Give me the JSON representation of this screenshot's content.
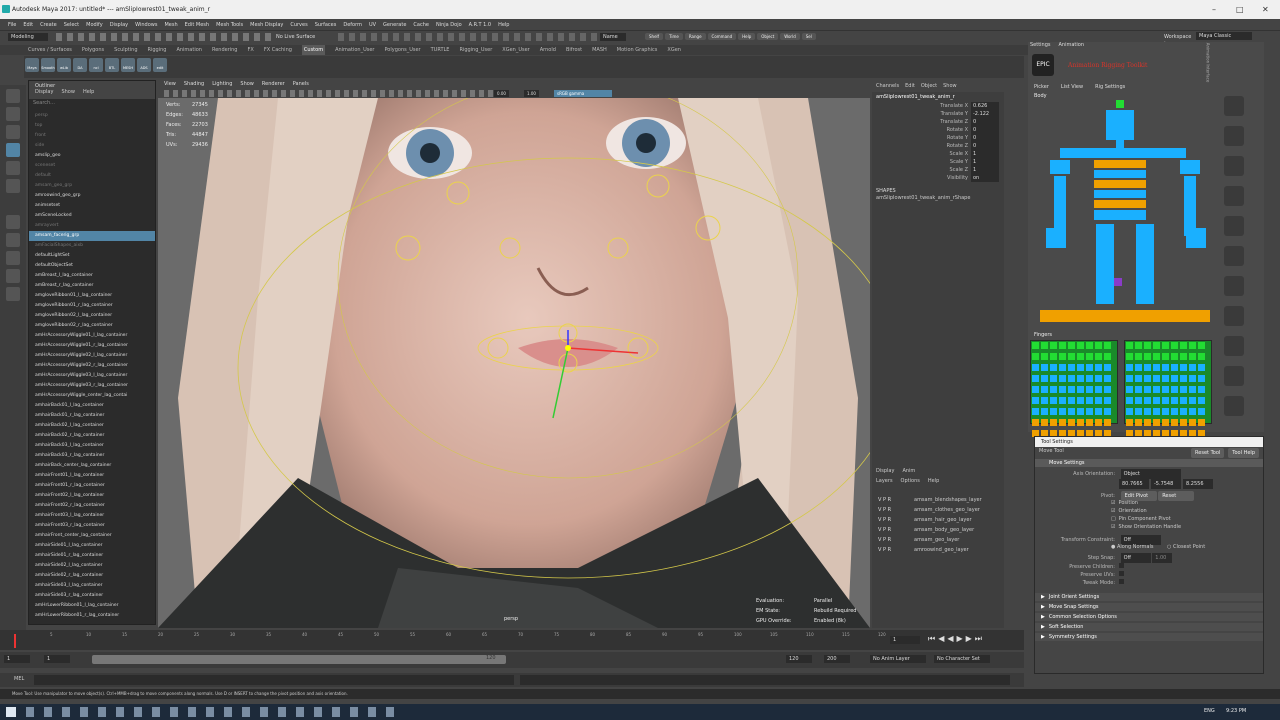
{
  "window": {
    "title": "Autodesk Maya 2017: untitled*   ---   amSlipIowrest01_tweak_anim_r"
  },
  "menus": [
    "File",
    "Edit",
    "Create",
    "Select",
    "Modify",
    "Display",
    "Windows",
    "Mesh",
    "Edit Mesh",
    "Mesh Tools",
    "Mesh Display",
    "Curves",
    "Surfaces",
    "Deform",
    "UV",
    "Generate",
    "Cache",
    "Ninja Dojo",
    "A.R.T 1.0",
    "Help"
  ],
  "status": {
    "mode": "Modeling",
    "live": "No Live Surface",
    "workspace_label": "Workspace :",
    "workspace": "Maya Classic",
    "symmetry": "Name"
  },
  "status_right": [
    "Shelf",
    "Time",
    "Range",
    "Command",
    "Help",
    "Object",
    "World",
    "Sel"
  ],
  "shelf_tabs": [
    "Curves / Surfaces",
    "Polygons",
    "Sculpting",
    "Rigging",
    "Animation",
    "Rendering",
    "FX",
    "FX Caching",
    "Custom",
    "Animation_User",
    "Polygons_User",
    "TURTLE",
    "Rigging_User",
    "XGen_User",
    "Arnold",
    "Bifrost",
    "MASH",
    "Motion Graphics",
    "XGen"
  ],
  "shelf_items": [
    "Maya",
    "Smooth",
    "wLib",
    "DA",
    "ncl",
    "BTL",
    "MESH",
    "ADS",
    "edit"
  ],
  "outliner": {
    "menus": [
      "Display",
      "Show",
      "Help"
    ],
    "search": "Search...",
    "items": [
      "persp",
      "top",
      "front",
      "side",
      "amslip_geo",
      "sceneset",
      "default",
      "amsam_geo_grp",
      "amroowind_geo_grp",
      "animsetset",
      "amSceneLocked",
      "amrayvert",
      "amsam_facerig_grp",
      "amFacialShapes_aixb",
      "defaultLightSet",
      "defaultObjectSet",
      "amBreast_l_lag_container",
      "amBreast_r_lag_container",
      "amgloveRibbon01_l_lag_container",
      "amgloveRibbon01_r_lag_container",
      "amgloveRibbon02_l_lag_container",
      "amgloveRibbon02_r_lag_container",
      "amHrAccessoryWiggle01_l_lag_container",
      "amHrAccessoryWiggle01_r_lag_container",
      "amHrAccessoryWiggle02_l_lag_container",
      "amHrAccessoryWiggle02_r_lag_container",
      "amHrAccessoryWiggle03_l_lag_container",
      "amHrAccessoryWiggle03_r_lag_container",
      "amHrAccessoryWiggle_center_lag_contai",
      "amhairBack01_l_lag_container",
      "amhairBack01_r_lag_container",
      "amhairBack02_l_lag_container",
      "amhairBack02_r_lag_container",
      "amhairBack03_l_lag_container",
      "amhairBack03_r_lag_container",
      "amhairBack_center_lag_container",
      "amhairFront01_l_lag_container",
      "amhairFront01_r_lag_container",
      "amhairFront02_l_lag_container",
      "amhairFront02_r_lag_container",
      "amhairFront03_l_lag_container",
      "amhairFront03_r_lag_container",
      "amhairFront_center_lag_container",
      "amhairSide01_l_lag_container",
      "amhairSide01_r_lag_container",
      "amhairSide02_l_lag_container",
      "amhairSide02_r_lag_container",
      "amhairSide03_l_lag_container",
      "amhairSide03_r_lag_container",
      "amHrLowerRibbon01_l_lag_container",
      "amHrLowerRibbon01_r_lag_container"
    ]
  },
  "viewport": {
    "menus": [
      "View",
      "Shading",
      "Lighting",
      "Show",
      "Renderer",
      "Panels"
    ],
    "gamma": "sRGB gamma",
    "value1": "0.00",
    "value2": "1.00",
    "hud": [
      [
        "Verts:",
        "27345"
      ],
      [
        "Edges:",
        "48633"
      ],
      [
        "Faces:",
        "22703"
      ],
      [
        "Tris:",
        "44847"
      ],
      [
        "UVs:",
        "29436"
      ]
    ],
    "hud_right": [
      [
        "Evaluation:",
        "Parallel"
      ],
      [
        "EM State:",
        "Rebuild Required"
      ],
      [
        "GPU Override:",
        "Enabled (8k)"
      ]
    ],
    "camera": "persp"
  },
  "channel_box": {
    "menus": [
      "Channels",
      "Edit",
      "Object",
      "Show"
    ],
    "object": "amSlipIowrest01_tweak_anim_r",
    "attrs": [
      [
        "Translate X",
        "0.626"
      ],
      [
        "Translate Y",
        "-2.122"
      ],
      [
        "Translate Z",
        "0"
      ],
      [
        "Rotate X",
        "0"
      ],
      [
        "Rotate Y",
        "0"
      ],
      [
        "Rotate Z",
        "0"
      ],
      [
        "Scale X",
        "1"
      ],
      [
        "Scale Y",
        "1"
      ],
      [
        "Scale Z",
        "1"
      ],
      [
        "Visibility",
        "on"
      ]
    ],
    "shapes_label": "SHAPES",
    "shape": "amSlipIowrest01_tweak_anim_rShape"
  },
  "layers": {
    "tabs": [
      "Display",
      "Anim"
    ],
    "menus": [
      "Layers",
      "Options",
      "Help"
    ],
    "items": [
      "amsam_blendshapes_layer",
      "amsam_clothes_geo_layer",
      "amsam_hair_geo_layer",
      "amsam_body_geo_layer",
      "amsam_geo_layer",
      "amroowind_geo_layer"
    ]
  },
  "picker": {
    "tabs": [
      "Settings",
      "Animation"
    ],
    "title": "Animation Interface",
    "subtabs": [
      "Picker",
      "List View",
      "Rig Settings"
    ],
    "logo": "EPIC",
    "brand": "Animation Rigging Toolkit",
    "body_label": "Body",
    "fingers_label": "Fingers",
    "side_icons": [
      "select-icon",
      "zero-icon",
      "run-icon",
      "run2-icon",
      "disc-icon",
      "figure-icon",
      "pen-icon",
      "import-icon",
      "eye-icon",
      "sets-icon",
      "help-icon"
    ]
  },
  "tool_settings": {
    "title": "Tool Settings",
    "tool": "Move Tool",
    "reset": "Reset Tool",
    "help": "Tool Help",
    "section": "Move Settings",
    "axis_label": "Axis Orientation:",
    "axis_value": "Object",
    "xyz": [
      "80.7665",
      "-5.7548",
      "8.2556"
    ],
    "pivot": "Pivot:",
    "edit_pivot": "Edit Pivot",
    "reset_btn": "Reset",
    "checks": [
      "Position",
      "Orientation",
      "Pin Component Pivot",
      "Show Orientation Handle"
    ],
    "tc_label": "Transform Constraint:",
    "tc_value": "Off",
    "along": "Along Normals",
    "closest": "Closest Point",
    "step_label": "Step Snap:",
    "step_value": "Off",
    "step_num": "1.00",
    "preserve": [
      "Preserve Children:",
      "Preserve UVs:",
      "Tweak Mode:"
    ],
    "sections": [
      "Joint Orient Settings",
      "Move Snap Settings",
      "Common Selection Options",
      "Soft Selection",
      "Symmetry Settings"
    ]
  },
  "time": {
    "start": "1",
    "end": "120",
    "range_start": "1",
    "range_end": "120",
    "range_max": "200",
    "current": "1",
    "anim_layer": "No Anim Layer",
    "char_set": "No Character Set",
    "ticks": [
      "5",
      "10",
      "15",
      "20",
      "25",
      "30",
      "35",
      "40",
      "45",
      "50",
      "55",
      "60",
      "65",
      "70",
      "75",
      "80",
      "85",
      "90",
      "95",
      "100",
      "105",
      "110",
      "115",
      "120"
    ]
  },
  "cmd": {
    "label": "MEL"
  },
  "help_text": "Move Tool: Use manipulator to move object(s). Ctrl+MMB+drag to move components along normals. Use D or INSERT to change the pivot position and axis orientation.",
  "taskbar": {
    "clock": "9:23 PM",
    "lang": "ENG"
  }
}
